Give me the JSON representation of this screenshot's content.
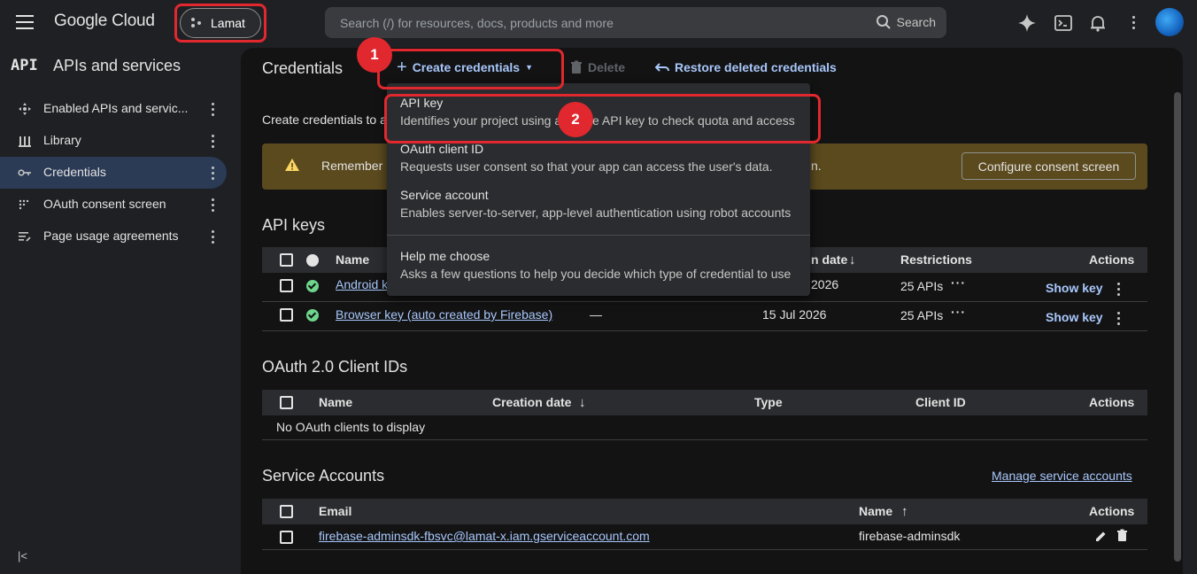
{
  "topbar": {
    "logo": "Google Cloud",
    "project": "Lamat",
    "search_placeholder": "Search (/) for resources, docs, products and more",
    "search_button": "Search"
  },
  "sidebar": {
    "logo": "API",
    "title": "APIs and services",
    "items": [
      {
        "label": "Enabled APIs and servic...",
        "icon": "enabled-apis-icon"
      },
      {
        "label": "Library",
        "icon": "library-icon"
      },
      {
        "label": "Credentials",
        "icon": "key-icon",
        "active": true
      },
      {
        "label": "OAuth consent screen",
        "icon": "consent-icon"
      },
      {
        "label": "Page usage agreements",
        "icon": "agreements-icon"
      }
    ]
  },
  "toolbar": {
    "title": "Credentials",
    "create": "Create credentials",
    "delete": "Delete",
    "restore": "Restore deleted credentials"
  },
  "main": {
    "description": "Create credentials to a",
    "banner_text": "Remember",
    "banner_text_end": "n.",
    "banner_button": "Configure consent screen"
  },
  "api_keys": {
    "title": "API keys",
    "headers": {
      "name": "Name",
      "creation_date": "n date",
      "restrictions": "Restrictions",
      "actions": "Actions"
    },
    "rows": [
      {
        "name": "Android k",
        "dash": "",
        "date": "2026",
        "restrictions": "25 APIs",
        "action": "Show key"
      },
      {
        "name": "Browser key (auto created by Firebase)",
        "dash": "—",
        "date": "15 Jul 2026",
        "restrictions": "25 APIs",
        "action": "Show key"
      }
    ]
  },
  "oauth": {
    "title": "OAuth 2.0 Client IDs",
    "headers": {
      "name": "Name",
      "creation_date": "Creation date",
      "type": "Type",
      "client_id": "Client ID",
      "actions": "Actions"
    },
    "empty": "No OAuth clients to display"
  },
  "service_accounts": {
    "title": "Service Accounts",
    "manage": "Manage service accounts",
    "headers": {
      "email": "Email",
      "name": "Name",
      "actions": "Actions"
    },
    "rows": [
      {
        "email": "firebase-adminsdk-fbsvc@lamat-x.iam.gserviceaccount.com",
        "name": "firebase-adminsdk"
      }
    ]
  },
  "menu": {
    "items": [
      {
        "title": "API key",
        "desc_a": "Identifies your project using a",
        "desc_b": "e API key to check quota and access"
      },
      {
        "title": "OAuth client ID",
        "desc": "Requests user consent so that your app can access the user's data."
      },
      {
        "title": "Service account",
        "desc": "Enables server-to-server, app-level authentication using robot accounts"
      },
      {
        "title": "Help me choose",
        "desc": "Asks a few questions to help you decide which type of credential to use"
      }
    ]
  },
  "annotations": {
    "step1": "1",
    "step2": "2",
    "color": "#e0282e"
  }
}
